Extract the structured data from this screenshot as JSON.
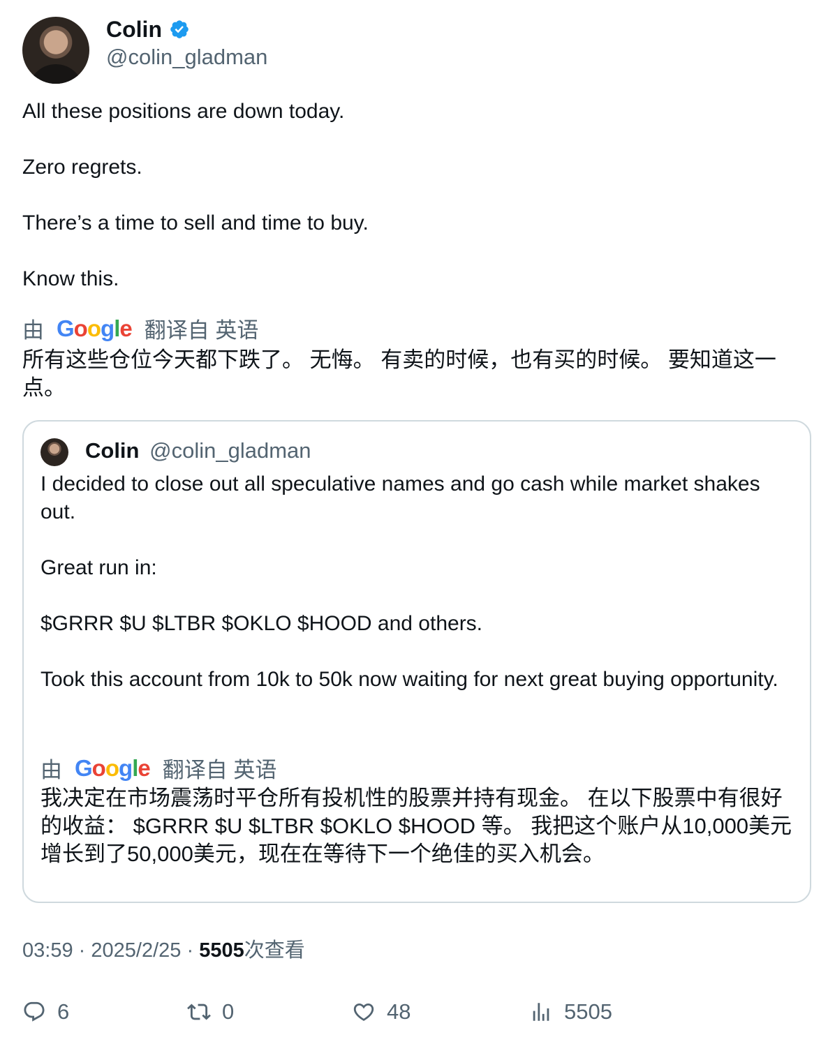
{
  "author": {
    "name": "Colin",
    "handle": "@colin_gladman",
    "verified": true
  },
  "tweet": {
    "text": "All these positions are down today.\n\nZero regrets.\n\nThere’s a time to sell and time to buy.\n\nKnow this.",
    "translation": {
      "prefix": "由",
      "brand": "Google",
      "suffix": "翻译自 英语",
      "text": "所有这些仓位今天都下跌了。 无悔。 有卖的时候，也有买的时候。 要知道这一点。"
    }
  },
  "quote": {
    "name": "Colin",
    "handle": "@colin_gladman",
    "text": "I decided to close out all speculative names and go cash while market shakes out.\n\nGreat run in:\n\n$GRRR $U $LTBR $OKLO $HOOD and others.\n\nTook this account from 10k to 50k now waiting for next great buying opportunity.",
    "translation": {
      "prefix": "由",
      "brand": "Google",
      "suffix": "翻译自 英语",
      "text": "我决定在市场震荡时平仓所有投机性的股票并持有现金。 在以下股票中有很好的收益： $GRRR $U $LTBR $OKLO $HOOD 等。 我把这个账户从10,000美元增长到了50,000美元，现在在等待下一个绝佳的买入机会。"
    }
  },
  "meta": {
    "time": "03:59",
    "sep1": "·",
    "date": "2025/2/25",
    "sep2": "·",
    "views": "5505",
    "views_label": "次查看"
  },
  "actions": {
    "replies": "6",
    "retweets": "0",
    "likes": "48",
    "views": "5505"
  },
  "colors": {
    "verified": "#1d9bf0",
    "secondary_text": "#536471",
    "border": "#cfd9de"
  }
}
